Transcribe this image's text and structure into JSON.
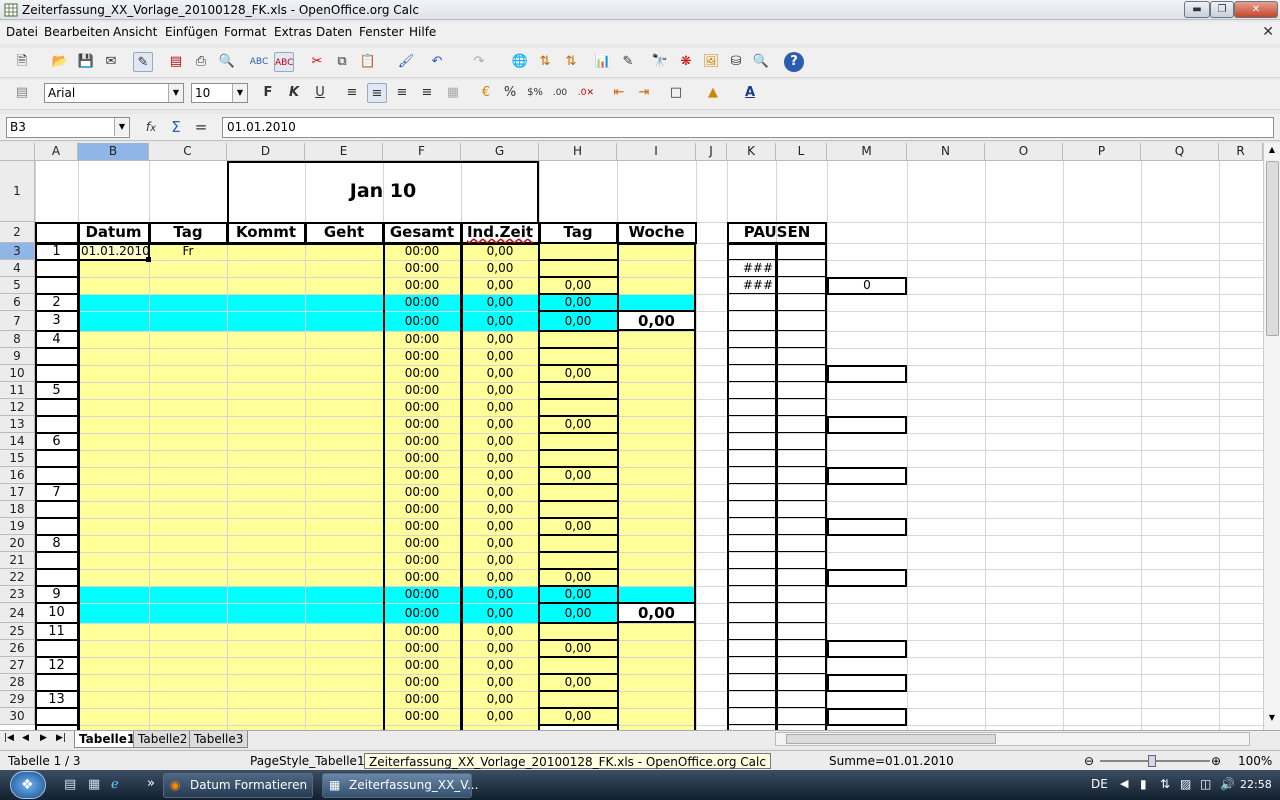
{
  "window": {
    "title": "Zeiterfassung_XX_Vorlage_20100128_FK.xls - OpenOffice.org Calc"
  },
  "menu": [
    "Datei",
    "Bearbeiten",
    "Ansicht",
    "Einfügen",
    "Format",
    "Extras",
    "Daten",
    "Fenster",
    "Hilfe"
  ],
  "format": {
    "font": "Arial",
    "size": "10"
  },
  "formula": {
    "cellref": "B3",
    "value": "01.01.2010"
  },
  "columns": [
    "A",
    "B",
    "C",
    "D",
    "E",
    "F",
    "G",
    "H",
    "I",
    "J",
    "K",
    "L",
    "M",
    "N",
    "O",
    "P",
    "Q",
    "R"
  ],
  "rows": [
    "1",
    "2",
    "3",
    "4",
    "5",
    "6",
    "7",
    "8",
    "9",
    "10",
    "11",
    "12",
    "13",
    "14",
    "15",
    "16",
    "17",
    "18",
    "19",
    "20",
    "21",
    "22",
    "23",
    "24",
    "25",
    "26",
    "27",
    "28",
    "29",
    "30"
  ],
  "sheet": {
    "title": "Jan 10",
    "headers": [
      "Datum",
      "Tag",
      "Kommt",
      "Geht",
      "Gesamt",
      "Ind.Zeit",
      "Tag",
      "Woche",
      "PAUSEN"
    ],
    "b3": "01.01.2010",
    "c3": "Fr",
    "colA": [
      "1",
      "",
      "",
      "2",
      "3",
      "4",
      "",
      "",
      "5",
      "",
      "",
      "6",
      "",
      "",
      "7",
      "",
      "",
      "8",
      "",
      "",
      "9",
      "10",
      "11",
      "",
      "12",
      "",
      "13",
      ""
    ],
    "colF": "00:00",
    "colG": "0,00",
    "colH": [
      "",
      "",
      "0,00",
      "0,00",
      "0,00",
      "",
      "",
      "0,00",
      "",
      "",
      "0,00",
      "",
      "",
      "0,00",
      "",
      "",
      "0,00",
      "",
      "",
      "0,00",
      "0,00",
      "0,00",
      "",
      "0,00",
      "",
      "0,00",
      "",
      "0,00"
    ],
    "woche": [
      {
        "row": 7,
        "value": "0,00"
      },
      {
        "row": 24,
        "value": "0,00"
      }
    ],
    "k4": "###",
    "k5": "###",
    "m5": "0"
  },
  "sheettabs": [
    "Tabelle1",
    "Tabelle2",
    "Tabelle3"
  ],
  "status": {
    "sheet": "Tabelle 1 / 3",
    "pagestyle": "PageStyle_Tabelle1",
    "tooltip": "Zeiterfassung_XX_Vorlage_20100128_FK.xls - OpenOffice.org Calc",
    "sum": "Summe=01.01.2010",
    "zoom": "100%"
  },
  "taskbar": {
    "items": [
      "Datum Formatieren ...",
      "Zeiterfassung_XX_V..."
    ],
    "lang": "DE",
    "time": "22:58"
  },
  "colors": {
    "yellow": "#ffff99",
    "cyan": "#00ffff",
    "selection": "#8fb6e6"
  }
}
